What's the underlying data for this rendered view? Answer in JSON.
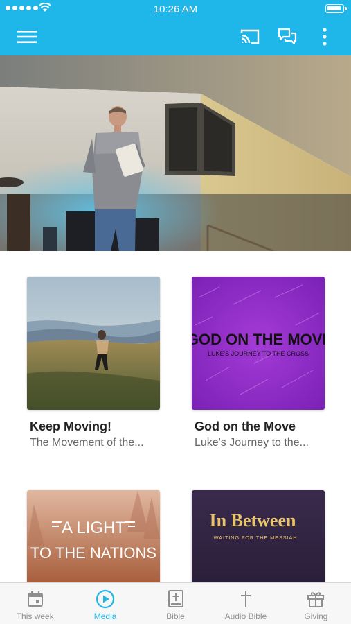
{
  "status_bar": {
    "time": "10:26 AM"
  },
  "app_bar": {
    "menu_icon": "hamburger-menu-icon",
    "actions": [
      "cast-icon",
      "chat-icon",
      "more-vertical-icon"
    ]
  },
  "colors": {
    "accent": "#1fb6ea",
    "tab_inactive": "#8e8e8e",
    "title_text": "#222222",
    "subtitle_text": "#666666"
  },
  "hero": {
    "image": "preacher-on-stage-photo"
  },
  "series": [
    {
      "title": "Keep Moving!",
      "subtitle": "The Movement of the...",
      "artwork": "person-walking-in-field-photo"
    },
    {
      "title": "God on the Move",
      "subtitle": "Luke's Journey to the...",
      "artwork": "purple-star-trails",
      "art_title": "GOD ON THE MOVE",
      "art_subtitle": "LUKE'S JOURNEY TO THE CROSS"
    },
    {
      "title": "",
      "subtitle": "",
      "artwork": "foggy-forest-orange",
      "art_line1": "A LIGHT",
      "art_line2": "TO THE NATIONS"
    },
    {
      "title": "",
      "subtitle": "",
      "artwork": "dark-purple-title-card",
      "art_title": "In Between",
      "art_subtitle": "WAITING FOR THE MESSIAH"
    }
  ],
  "tabs": [
    {
      "label": "This week",
      "icon": "calendar-icon",
      "active": false
    },
    {
      "label": "Media",
      "icon": "play-circle-icon",
      "active": true
    },
    {
      "label": "Bible",
      "icon": "bible-icon",
      "active": false
    },
    {
      "label": "Audio Bible",
      "icon": "cross-icon",
      "active": false
    },
    {
      "label": "Giving",
      "icon": "gift-icon",
      "active": false
    }
  ]
}
